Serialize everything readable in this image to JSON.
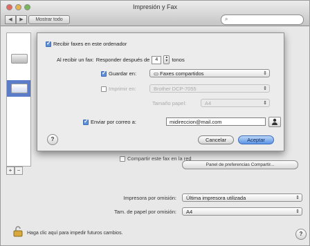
{
  "window": {
    "title": "Impresión y Fax",
    "nav_back": "◀",
    "nav_forward": "▶",
    "show_all": "Mostrar todo",
    "search_placeholder": ""
  },
  "sheet": {
    "receive_faxes_label": "Recibir faxes en este ordenador",
    "receive_faxes_checked": true,
    "answer_prefix": "Al recibir un fax:",
    "answer_after": "Responder después de",
    "rings_value": "4",
    "rings_unit": "tonos",
    "save_in_label": "Guardar en:",
    "save_in_checked": true,
    "save_in_value": "Faxes compartidos",
    "print_on_label": "Imprimir en:",
    "print_on_checked": false,
    "print_on_value": "Brother DCP-7055",
    "paper_size_label": "Tamaño papel:",
    "paper_size_value": "A4",
    "email_label": "Enviar por correo a:",
    "email_checked": true,
    "email_value": "midireccion@mail.com",
    "contacts_icon": "person-icon",
    "help": "?",
    "cancel_label": "Cancelar",
    "ok_label": "Aceptar"
  },
  "background": {
    "share_fax_label": "Compartir este fax en la red",
    "share_fax_checked": false,
    "prefs_button": "Panel de preferencias Compartir...",
    "add": "+",
    "remove": "−",
    "default_printer_label": "Impresora por omisión:",
    "default_printer_value": "Última impresora utilizada",
    "default_paper_label": "Tam. de papel por omisión:",
    "default_paper_value": "A4",
    "lock_text": "Haga clic aquí para impedir futuros cambios.",
    "help": "?"
  },
  "colors": {
    "accent": "#5e8fd6",
    "selection": "#5b7cc9"
  }
}
